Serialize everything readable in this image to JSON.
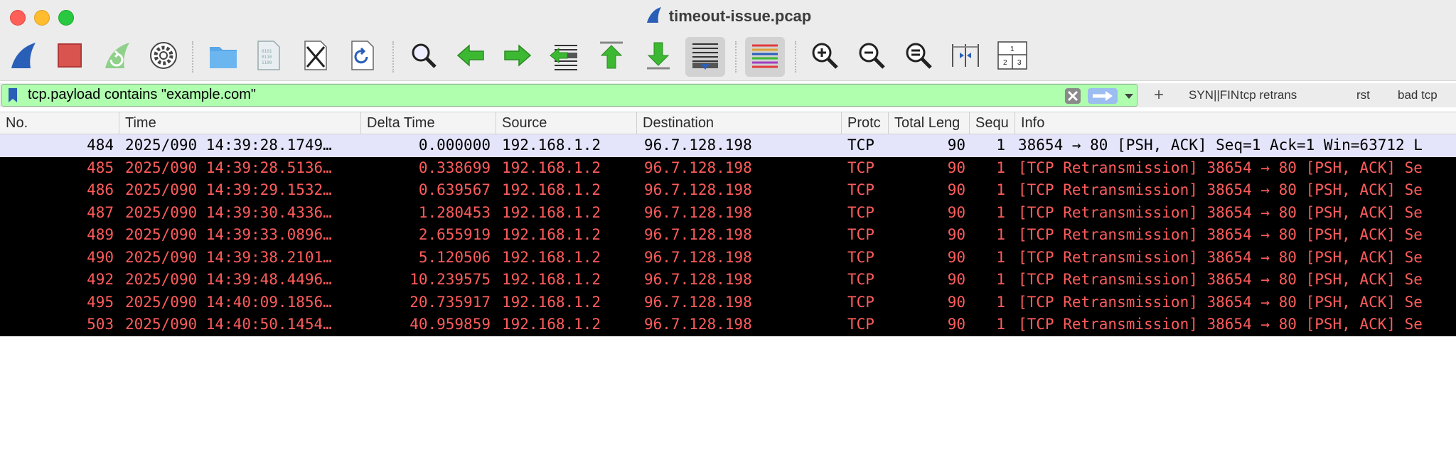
{
  "window": {
    "title": "timeout-issue.pcap"
  },
  "toolbar": {
    "buttons": [
      {
        "name": "start-capture",
        "icon": "shark-fin-icon"
      },
      {
        "name": "stop-capture",
        "icon": "stop-square-icon"
      },
      {
        "name": "restart-capture",
        "icon": "restart-fin-icon"
      },
      {
        "name": "capture-options",
        "icon": "gear-icon"
      },
      {
        "name": "open-file",
        "icon": "folder-icon"
      },
      {
        "name": "save-file",
        "icon": "binary-file-icon"
      },
      {
        "name": "close-file",
        "icon": "close-file-icon"
      },
      {
        "name": "reload-file",
        "icon": "reload-file-icon"
      },
      {
        "name": "find-packet",
        "icon": "magnifier-icon"
      },
      {
        "name": "go-back",
        "icon": "arrow-left-icon"
      },
      {
        "name": "go-forward",
        "icon": "arrow-right-icon"
      },
      {
        "name": "go-to-packet",
        "icon": "jump-to-packet-icon"
      },
      {
        "name": "go-first",
        "icon": "go-first-icon"
      },
      {
        "name": "go-last",
        "icon": "go-last-icon"
      },
      {
        "name": "auto-scroll",
        "icon": "autoscroll-icon"
      },
      {
        "name": "colorize",
        "icon": "colorize-icon"
      },
      {
        "name": "zoom-in",
        "icon": "zoom-in-icon"
      },
      {
        "name": "zoom-out",
        "icon": "zoom-out-icon"
      },
      {
        "name": "zoom-reset",
        "icon": "zoom-reset-icon"
      },
      {
        "name": "resize-columns",
        "icon": "resize-columns-icon"
      },
      {
        "name": "layout-panes",
        "icon": "layout-panes-icon"
      }
    ],
    "layout_labels": [
      "1",
      "2",
      "3"
    ],
    "file_icon_digits": [
      "0101",
      "0110",
      "1100"
    ]
  },
  "filter": {
    "text": "tcp.payload contains \"example.com\"",
    "add_label": "+",
    "buttons": [
      "SYN||FIN",
      "tcp retrans",
      "rst",
      "bad tcp"
    ],
    "bg_color": "#afffaf"
  },
  "packet_list": {
    "columns": [
      "No.",
      "Time",
      "Delta Time",
      "Source",
      "Destination",
      "Protc",
      "Total Leng",
      "Sequ",
      "Info"
    ],
    "rows": [
      {
        "no": "484",
        "time": "2025/090 14:39:28.1749…",
        "delta": "0.000000",
        "src": "192.168.1.2",
        "dst": "96.7.128.198",
        "proto": "TCP",
        "len": "90",
        "seq": "1",
        "info": "38654 → 80 [PSH, ACK] Seq=1 Ack=1 Win=63712 L",
        "style": "selected"
      },
      {
        "no": "485",
        "time": "2025/090 14:39:28.5136…",
        "delta": "0.338699",
        "src": "192.168.1.2",
        "dst": "96.7.128.198",
        "proto": "TCP",
        "len": "90",
        "seq": "1",
        "info": "[TCP Retransmission] 38654 → 80 [PSH, ACK] Se",
        "style": "bad"
      },
      {
        "no": "486",
        "time": "2025/090 14:39:29.1532…",
        "delta": "0.639567",
        "src": "192.168.1.2",
        "dst": "96.7.128.198",
        "proto": "TCP",
        "len": "90",
        "seq": "1",
        "info": "[TCP Retransmission] 38654 → 80 [PSH, ACK] Se",
        "style": "bad"
      },
      {
        "no": "487",
        "time": "2025/090 14:39:30.4336…",
        "delta": "1.280453",
        "src": "192.168.1.2",
        "dst": "96.7.128.198",
        "proto": "TCP",
        "len": "90",
        "seq": "1",
        "info": "[TCP Retransmission] 38654 → 80 [PSH, ACK] Se",
        "style": "bad"
      },
      {
        "no": "489",
        "time": "2025/090 14:39:33.0896…",
        "delta": "2.655919",
        "src": "192.168.1.2",
        "dst": "96.7.128.198",
        "proto": "TCP",
        "len": "90",
        "seq": "1",
        "info": "[TCP Retransmission] 38654 → 80 [PSH, ACK] Se",
        "style": "bad"
      },
      {
        "no": "490",
        "time": "2025/090 14:39:38.2101…",
        "delta": "5.120506",
        "src": "192.168.1.2",
        "dst": "96.7.128.198",
        "proto": "TCP",
        "len": "90",
        "seq": "1",
        "info": "[TCP Retransmission] 38654 → 80 [PSH, ACK] Se",
        "style": "bad"
      },
      {
        "no": "492",
        "time": "2025/090 14:39:48.4496…",
        "delta": "10.239575",
        "src": "192.168.1.2",
        "dst": "96.7.128.198",
        "proto": "TCP",
        "len": "90",
        "seq": "1",
        "info": "[TCP Retransmission] 38654 → 80 [PSH, ACK] Se",
        "style": "bad"
      },
      {
        "no": "495",
        "time": "2025/090 14:40:09.1856…",
        "delta": "20.735917",
        "src": "192.168.1.2",
        "dst": "96.7.128.198",
        "proto": "TCP",
        "len": "90",
        "seq": "1",
        "info": "[TCP Retransmission] 38654 → 80 [PSH, ACK] Se",
        "style": "bad"
      },
      {
        "no": "503",
        "time": "2025/090 14:40:50.1454…",
        "delta": "40.959859",
        "src": "192.168.1.2",
        "dst": "96.7.128.198",
        "proto": "TCP",
        "len": "90",
        "seq": "1",
        "info": "[TCP Retransmission] 38654 → 80 [PSH, ACK] Se",
        "style": "bad"
      }
    ]
  },
  "colors": {
    "selected_row_bg": "#e4e4fa",
    "bad_row_bg": "#000000",
    "bad_row_fg": "#ff5c5c",
    "shark_blue": "#2a5fb8",
    "stop_red": "#d9534f",
    "arrow_green": "#3db832"
  }
}
